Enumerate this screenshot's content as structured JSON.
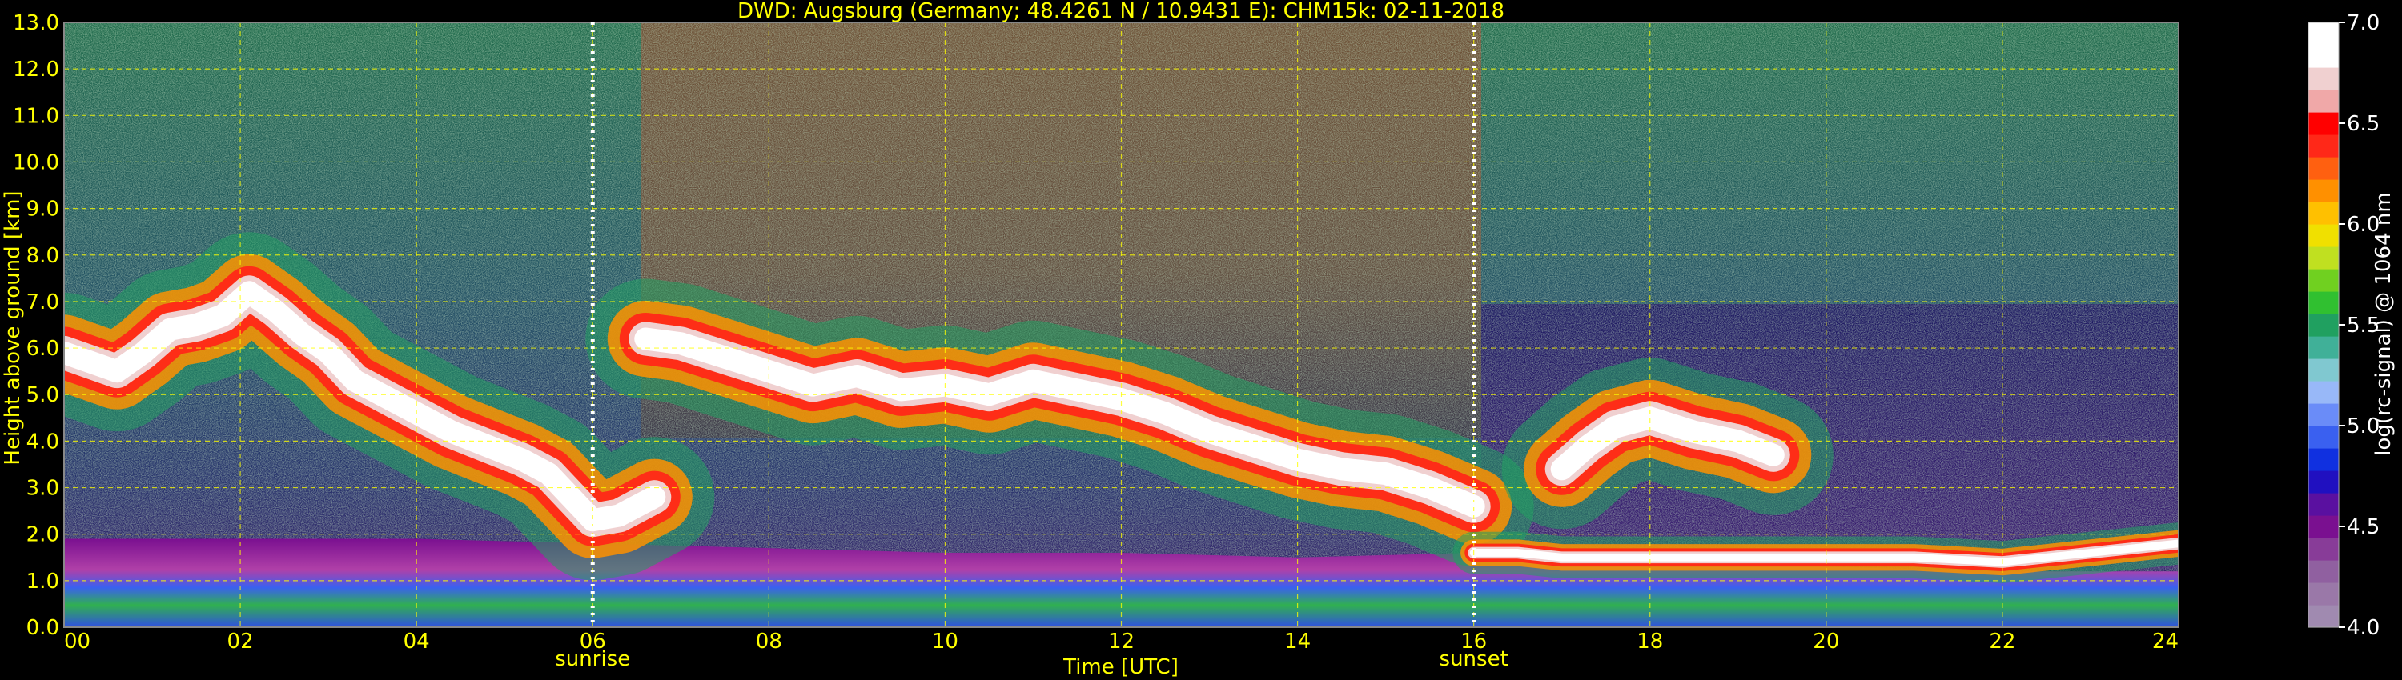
{
  "chart_data": {
    "type": "heatmap",
    "title": "DWD: Augsburg (Germany; 48.4261 N / 10.9431 E):    CHM15k: 02-11-2018",
    "xlabel": "Time [UTC]",
    "ylabel": "Height above ground [km]",
    "xlim": [
      0,
      24
    ],
    "ylim": [
      0,
      13
    ],
    "x_ticks": [
      "00",
      "02",
      "04",
      "06",
      "08",
      "10",
      "12",
      "14",
      "16",
      "18",
      "20",
      "22",
      "24"
    ],
    "x_tick_values": [
      0,
      2,
      4,
      6,
      8,
      10,
      12,
      14,
      16,
      18,
      20,
      22,
      24
    ],
    "y_ticks": [
      "0.0",
      "1.0",
      "2.0",
      "3.0",
      "4.0",
      "5.0",
      "6.0",
      "7.0",
      "8.0",
      "9.0",
      "10.0",
      "11.0",
      "12.0",
      "13.0"
    ],
    "y_tick_values": [
      0,
      1,
      2,
      3,
      4,
      5,
      6,
      7,
      8,
      9,
      10,
      11,
      12,
      13
    ],
    "grid": true,
    "annotations": [
      {
        "text": "sunrise",
        "x": 6.0
      },
      {
        "text": "sunset",
        "x": 16.0
      }
    ],
    "colorbar": {
      "label": "log(rc-signal) @ 1064 nm",
      "range": [
        4.0,
        7.0
      ],
      "ticks": [
        "4.0",
        "4.5",
        "5.0",
        "5.5",
        "6.0",
        "6.5",
        "7.0"
      ],
      "tick_values": [
        4.0,
        4.5,
        5.0,
        5.5,
        6.0,
        6.5,
        7.0
      ],
      "colors": [
        "#a08ab0",
        "#9a78a8",
        "#9060a0",
        "#883c98",
        "#7a1090",
        "#5a10a0",
        "#2010c0",
        "#1030e0",
        "#3a60f0",
        "#6a8cf8",
        "#98b8f8",
        "#80c8d0",
        "#40b098",
        "#20a060",
        "#30c030",
        "#70d020",
        "#c0e020",
        "#f0e000",
        "#ffc000",
        "#ff9000",
        "#ff6010",
        "#ff2818",
        "#ff0000",
        "#f0a8a8",
        "#f0d0d0",
        "#ffffff",
        "#ffffff"
      ]
    },
    "cloud_layers": [
      {
        "x": [
          0.0,
          0.3,
          0.6,
          0.9,
          1.2,
          1.5,
          1.8,
          2.1,
          2.4,
          2.7,
          3.0,
          3.3,
          3.6,
          4.0,
          4.4,
          4.8,
          5.2,
          5.5,
          5.8,
          6.0,
          6.3,
          6.7
        ],
        "y": [
          5.9,
          5.7,
          5.5,
          5.9,
          6.4,
          6.5,
          6.7,
          7.2,
          6.8,
          6.3,
          5.9,
          5.3,
          5.0,
          4.6,
          4.2,
          3.9,
          3.6,
          3.3,
          2.7,
          2.3,
          2.4,
          2.8
        ]
      },
      {
        "x": [
          6.6,
          7.0,
          7.5,
          8.0,
          8.5,
          9.0,
          9.5,
          10.0,
          10.5,
          11.0,
          11.5,
          12.0,
          12.5,
          13.0,
          13.5,
          14.0,
          14.5,
          15.0,
          15.5,
          16.0
        ],
        "y": [
          6.2,
          6.1,
          5.8,
          5.5,
          5.2,
          5.4,
          5.1,
          5.2,
          5.0,
          5.3,
          5.1,
          4.9,
          4.6,
          4.2,
          3.9,
          3.6,
          3.4,
          3.3,
          3.0,
          2.6
        ]
      },
      {
        "x": [
          17.0,
          17.3,
          17.6,
          18.0,
          18.5,
          19.0,
          19.4
        ],
        "y": [
          3.4,
          3.9,
          4.3,
          4.5,
          4.2,
          4.0,
          3.7
        ]
      },
      {
        "x": [
          16.0,
          16.5,
          17.0,
          18.0,
          19.0,
          20.0,
          21.0,
          22.0,
          23.0,
          24.0
        ],
        "y": [
          1.6,
          1.6,
          1.5,
          1.5,
          1.5,
          1.5,
          1.5,
          1.4,
          1.6,
          1.8
        ]
      }
    ],
    "boundary_layer": {
      "x": [
        0,
        4,
        6,
        8,
        10,
        12,
        14,
        16,
        18,
        20,
        22,
        24
      ],
      "top_km": [
        1.9,
        1.9,
        1.8,
        1.7,
        1.6,
        1.6,
        1.5,
        1.6,
        1.5,
        1.3,
        1.2,
        1.2
      ]
    }
  }
}
